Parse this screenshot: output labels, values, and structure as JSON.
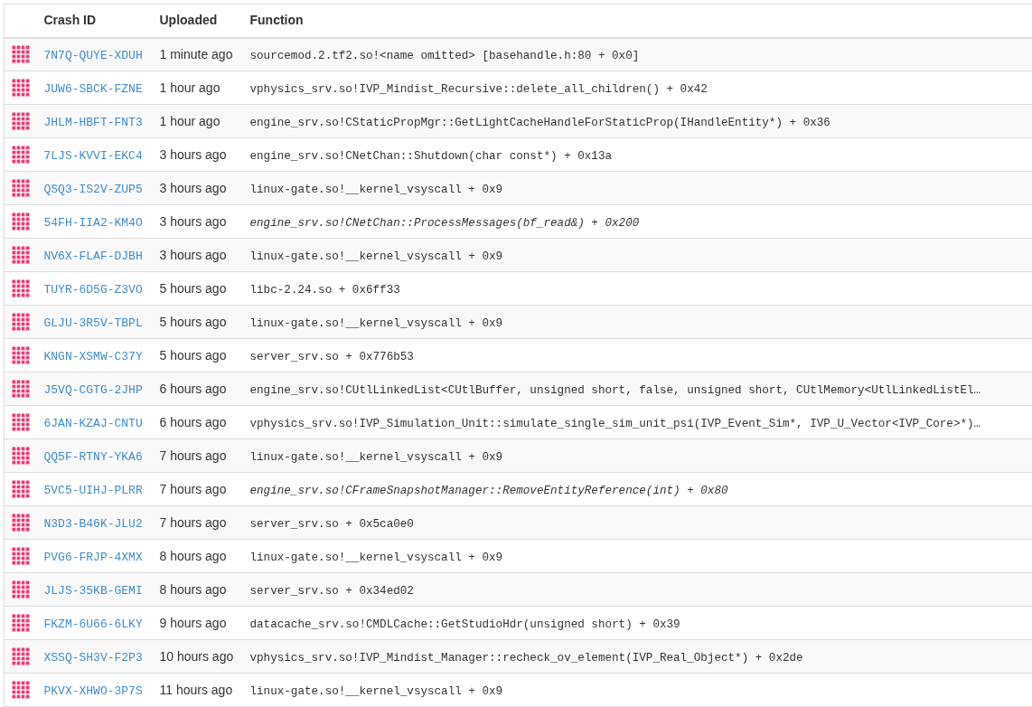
{
  "table": {
    "columns": [
      "Crash ID",
      "Uploaded",
      "Function"
    ],
    "rows": [
      {
        "crash_id": "7N7Q-QUYE-XDUH",
        "uploaded": "1 minute ago",
        "function": "sourcemod.2.tf2.so!<name omitted> [basehandle.h:80 + 0x0]",
        "italic": false
      },
      {
        "crash_id": "JUW6-SBCK-FZNE",
        "uploaded": "1 hour ago",
        "function": "vphysics_srv.so!IVP_Mindist_Recursive::delete_all_children() + 0x42",
        "italic": false
      },
      {
        "crash_id": "JHLM-HBFT-FNT3",
        "uploaded": "1 hour ago",
        "function": "engine_srv.so!CStaticPropMgr::GetLightCacheHandleForStaticProp(IHandleEntity*) + 0x36",
        "italic": false
      },
      {
        "crash_id": "7LJS-KVVI-EKC4",
        "uploaded": "3 hours ago",
        "function": "engine_srv.so!CNetChan::Shutdown(char const*) + 0x13a",
        "italic": false
      },
      {
        "crash_id": "QSQ3-IS2V-ZUP5",
        "uploaded": "3 hours ago",
        "function": "linux-gate.so!__kernel_vsyscall + 0x9",
        "italic": false
      },
      {
        "crash_id": "54FH-IIA2-KM4O",
        "uploaded": "3 hours ago",
        "function": "engine_srv.so!CNetChan::ProcessMessages(bf_read&) + 0x200",
        "italic": true
      },
      {
        "crash_id": "NV6X-FLAF-DJBH",
        "uploaded": "3 hours ago",
        "function": "linux-gate.so!__kernel_vsyscall + 0x9",
        "italic": false
      },
      {
        "crash_id": "TUYR-6D5G-Z3VO",
        "uploaded": "5 hours ago",
        "function": "libc-2.24.so + 0x6ff33",
        "italic": false
      },
      {
        "crash_id": "GLJU-3R5V-TBPL",
        "uploaded": "5 hours ago",
        "function": "linux-gate.so!__kernel_vsyscall + 0x9",
        "italic": false
      },
      {
        "crash_id": "KNGN-XSMW-C37Y",
        "uploaded": "5 hours ago",
        "function": "server_srv.so + 0x776b53",
        "italic": false
      },
      {
        "crash_id": "J5VQ-CGTG-2JHP",
        "uploaded": "6 hours ago",
        "function": "engine_srv.so!CUtlLinkedList<CUtlBuffer, unsigned short, false, unsigned short, CUtlMemory<UtlLinkedListEl…",
        "italic": false
      },
      {
        "crash_id": "6JAN-KZAJ-CNTU",
        "uploaded": "6 hours ago",
        "function": "vphysics_srv.so!IVP_Simulation_Unit::simulate_single_sim_unit_psi(IVP_Event_Sim*, IVP_U_Vector<IVP_Core>*)…",
        "italic": false
      },
      {
        "crash_id": "QQ5F-RTNY-YKA6",
        "uploaded": "7 hours ago",
        "function": "linux-gate.so!__kernel_vsyscall + 0x9",
        "italic": false
      },
      {
        "crash_id": "5VC5-UIHJ-PLRR",
        "uploaded": "7 hours ago",
        "function": "engine_srv.so!CFrameSnapshotManager::RemoveEntityReference(int) + 0x80",
        "italic": true
      },
      {
        "crash_id": "N3D3-B46K-JLU2",
        "uploaded": "7 hours ago",
        "function": "server_srv.so + 0x5ca0e0",
        "italic": false
      },
      {
        "crash_id": "PVG6-FRJP-4XMX",
        "uploaded": "8 hours ago",
        "function": "linux-gate.so!__kernel_vsyscall + 0x9",
        "italic": false
      },
      {
        "crash_id": "JLJS-35KB-GEMI",
        "uploaded": "8 hours ago",
        "function": "server_srv.so + 0x34ed02",
        "italic": false
      },
      {
        "crash_id": "FKZM-6U66-6LKY",
        "uploaded": "9 hours ago",
        "function": "datacache_srv.so!CMDLCache::GetStudioHdr(unsigned short) + 0x39",
        "italic": false
      },
      {
        "crash_id": "XSSQ-SH3V-F2P3",
        "uploaded": "10 hours ago",
        "function": "vphysics_srv.so!IVP_Mindist_Manager::recheck_ov_element(IVP_Real_Object*) + 0x2de",
        "italic": false
      },
      {
        "crash_id": "PKVX-XHWO-3P7S",
        "uploaded": "11 hours ago",
        "function": "linux-gate.so!__kernel_vsyscall + 0x9",
        "italic": false
      }
    ]
  }
}
